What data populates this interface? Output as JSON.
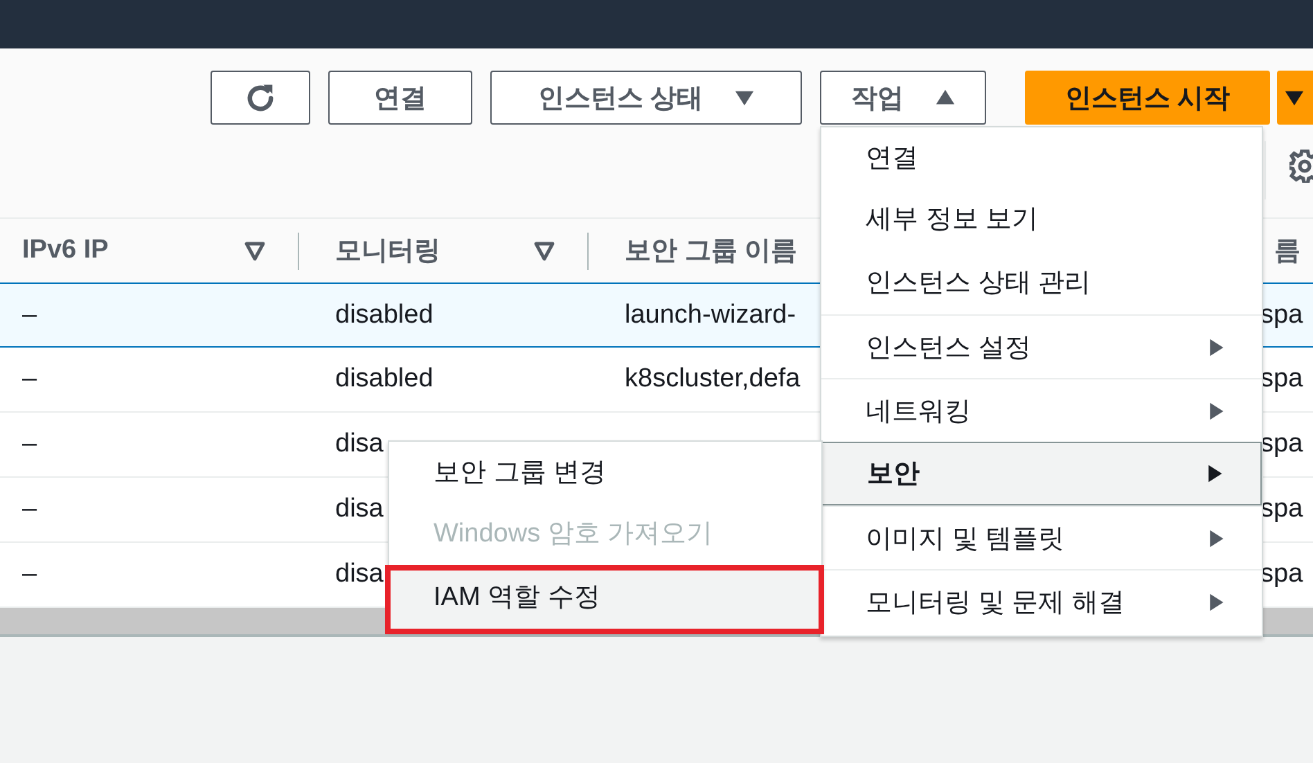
{
  "toolbar": {
    "buttons": [
      {
        "kind": "icon"
      },
      {
        "kind": "plain",
        "label": "연결"
      },
      {
        "kind": "dropdown",
        "label": "인스턴스 상태",
        "expanded": false
      },
      {
        "kind": "dropdown",
        "label": "작업",
        "expanded": true
      },
      {
        "kind": "primary",
        "label": "인스턴스 시작"
      },
      {
        "kind": "split",
        "expanded": false
      }
    ]
  },
  "table": {
    "columns": [
      {
        "label": "IPv6 IP",
        "filter": true
      },
      {
        "label": "모니터링",
        "filter": true
      },
      {
        "label": "보안 그룹 이름"
      },
      {
        "label": "름"
      }
    ],
    "rows": [
      {
        "selected": true,
        "cells": [
          "–",
          "disabled",
          "launch-wizard-",
          "spa"
        ]
      },
      {
        "selected": false,
        "cells": [
          "–",
          "disabled",
          "k8scluster,defa",
          "spa"
        ]
      },
      {
        "selected": false,
        "cells": [
          "–",
          "disa",
          null,
          "spa"
        ]
      },
      {
        "selected": false,
        "cells": [
          "–",
          "disa",
          null,
          "spa"
        ]
      },
      {
        "selected": false,
        "cells": [
          "–",
          "disa",
          null,
          "spa"
        ]
      }
    ]
  },
  "actions_menu": {
    "items": [
      {
        "label": "연결",
        "submenu": false,
        "selected": false,
        "divider_above": false
      },
      {
        "label": "세부 정보 보기",
        "submenu": false,
        "selected": false,
        "divider_above": false
      },
      {
        "label": "인스턴스 상태 관리",
        "submenu": false,
        "selected": false,
        "divider_above": false
      },
      {
        "label": "인스턴스 설정",
        "submenu": true,
        "selected": false,
        "divider_above": true
      },
      {
        "label": "네트워킹",
        "submenu": true,
        "selected": false,
        "divider_above": true
      },
      {
        "label": "보안",
        "submenu": true,
        "selected": true,
        "divider_above": true
      },
      {
        "label": "이미지 및 템플릿",
        "submenu": true,
        "selected": false,
        "divider_above": true
      },
      {
        "label": "모니터링 및 문제 해결",
        "submenu": true,
        "selected": false,
        "divider_above": true
      }
    ]
  },
  "security_submenu": {
    "items": [
      {
        "label": "보안 그룹 변경",
        "disabled": false,
        "selected": false,
        "marked": false
      },
      {
        "label": "Windows 암호 가져오기",
        "disabled": true,
        "selected": false,
        "marked": false
      },
      {
        "label": "IAM 역할 수정",
        "disabled": false,
        "selected": true,
        "marked": true
      }
    ]
  }
}
